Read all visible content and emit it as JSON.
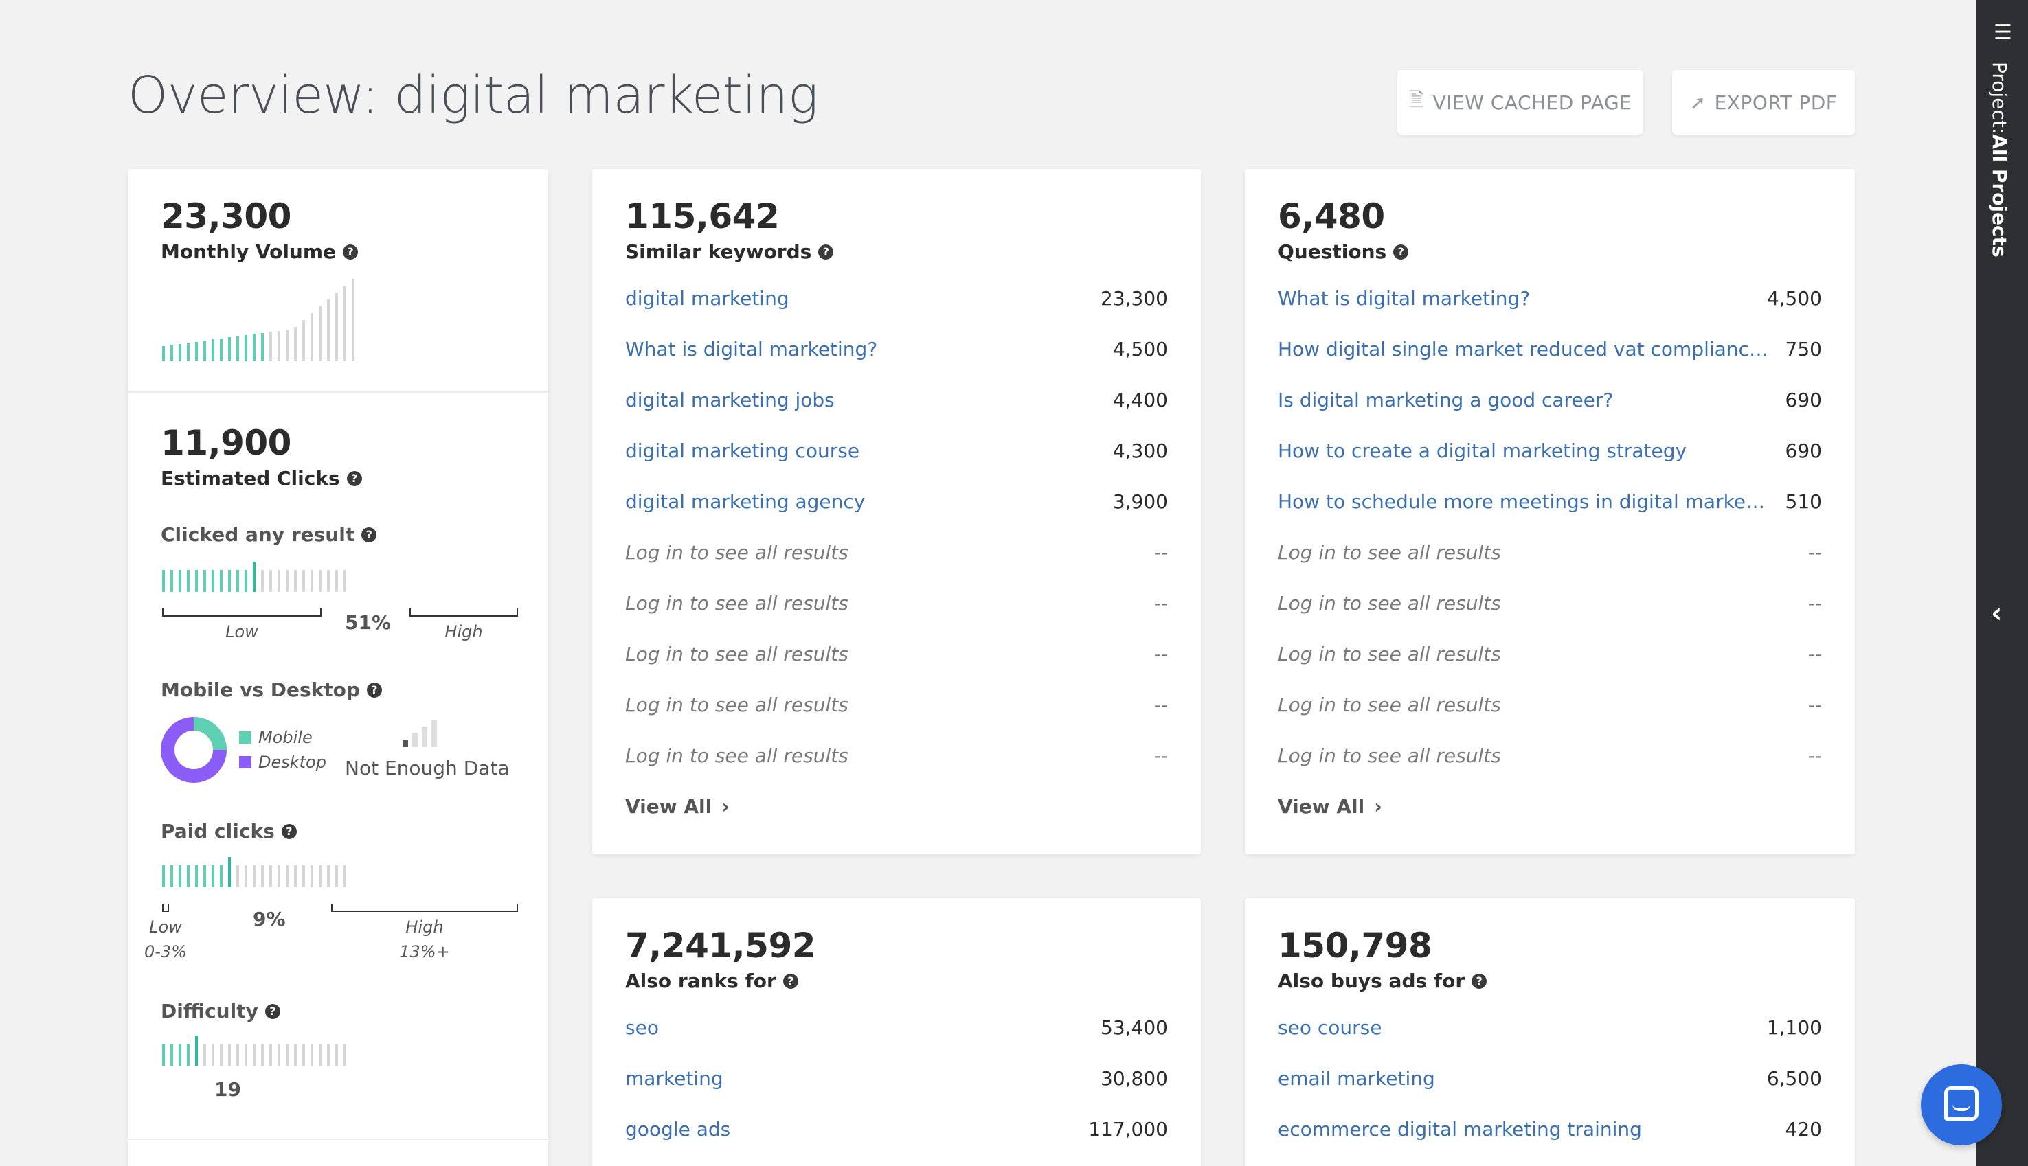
{
  "header": {
    "title": "Overview: digital marketing",
    "view_cached_label": "VIEW CACHED PAGE",
    "export_pdf_label": "EXPORT PDF"
  },
  "left_panel": {
    "monthly_volume": {
      "value": "23,300",
      "label": "Monthly Volume"
    },
    "estimated_clicks": {
      "value": "11,900",
      "label": "Estimated Clicks"
    },
    "clicked_any": {
      "label": "Clicked any result",
      "percent": "51%",
      "low": "Low",
      "high": "High",
      "level": 0.51
    },
    "mobile_desktop": {
      "label": "Mobile vs Desktop",
      "mobile": "Mobile",
      "desktop": "Desktop",
      "note": "Not Enough Data",
      "mobile_color": "#5fcfb4",
      "desktop_color": "#8b5cf6"
    },
    "paid_clicks": {
      "label": "Paid clicks",
      "percent": "9%",
      "low": "Low",
      "low_range": "0-3%",
      "high": "High",
      "high_range": "13%+",
      "level": 0.36
    },
    "difficulty": {
      "label": "Difficulty",
      "value": "19",
      "level": 0.19
    }
  },
  "similar": {
    "count": "115,642",
    "label": "Similar keywords",
    "rows": [
      {
        "kw": "digital marketing",
        "vol": "23,300"
      },
      {
        "kw": "What is digital marketing?",
        "vol": "4,500"
      },
      {
        "kw": "digital marketing jobs",
        "vol": "4,400"
      },
      {
        "kw": "digital marketing course",
        "vol": "4,300"
      },
      {
        "kw": "digital marketing agency",
        "vol": "3,900"
      },
      {
        "kw": "Log in to see all results",
        "vol": "--"
      },
      {
        "kw": "Log in to see all results",
        "vol": "--"
      },
      {
        "kw": "Log in to see all results",
        "vol": "--"
      },
      {
        "kw": "Log in to see all results",
        "vol": "--"
      },
      {
        "kw": "Log in to see all results",
        "vol": "--"
      }
    ],
    "view_all": "View All"
  },
  "questions": {
    "count": "6,480",
    "label": "Questions",
    "rows": [
      {
        "kw": "What is digital marketing?",
        "vol": "4,500"
      },
      {
        "kw": "How digital single market reduced vat compliance co...",
        "vol": "750"
      },
      {
        "kw": "Is digital marketing a good career?",
        "vol": "690"
      },
      {
        "kw": "How to create a digital marketing strategy",
        "vol": "690"
      },
      {
        "kw": "How to schedule more meetings in digital marketing",
        "vol": "510"
      },
      {
        "kw": "Log in to see all results",
        "vol": "--"
      },
      {
        "kw": "Log in to see all results",
        "vol": "--"
      },
      {
        "kw": "Log in to see all results",
        "vol": "--"
      },
      {
        "kw": "Log in to see all results",
        "vol": "--"
      },
      {
        "kw": "Log in to see all results",
        "vol": "--"
      }
    ],
    "view_all": "View All"
  },
  "also_ranks": {
    "count": "7,241,592",
    "label": "Also ranks for",
    "rows": [
      {
        "kw": "seo",
        "vol": "53,400"
      },
      {
        "kw": "marketing",
        "vol": "30,800"
      },
      {
        "kw": "google ads",
        "vol": "117,000"
      }
    ]
  },
  "also_buys": {
    "count": "150,798",
    "label": "Also buys ads for",
    "rows": [
      {
        "kw": "seo course",
        "vol": "1,100"
      },
      {
        "kw": "email marketing",
        "vol": "6,500"
      },
      {
        "kw": "ecommerce digital marketing training",
        "vol": "420"
      }
    ]
  },
  "sidebar": {
    "prefix": "Project:",
    "value": "All Projects"
  }
}
